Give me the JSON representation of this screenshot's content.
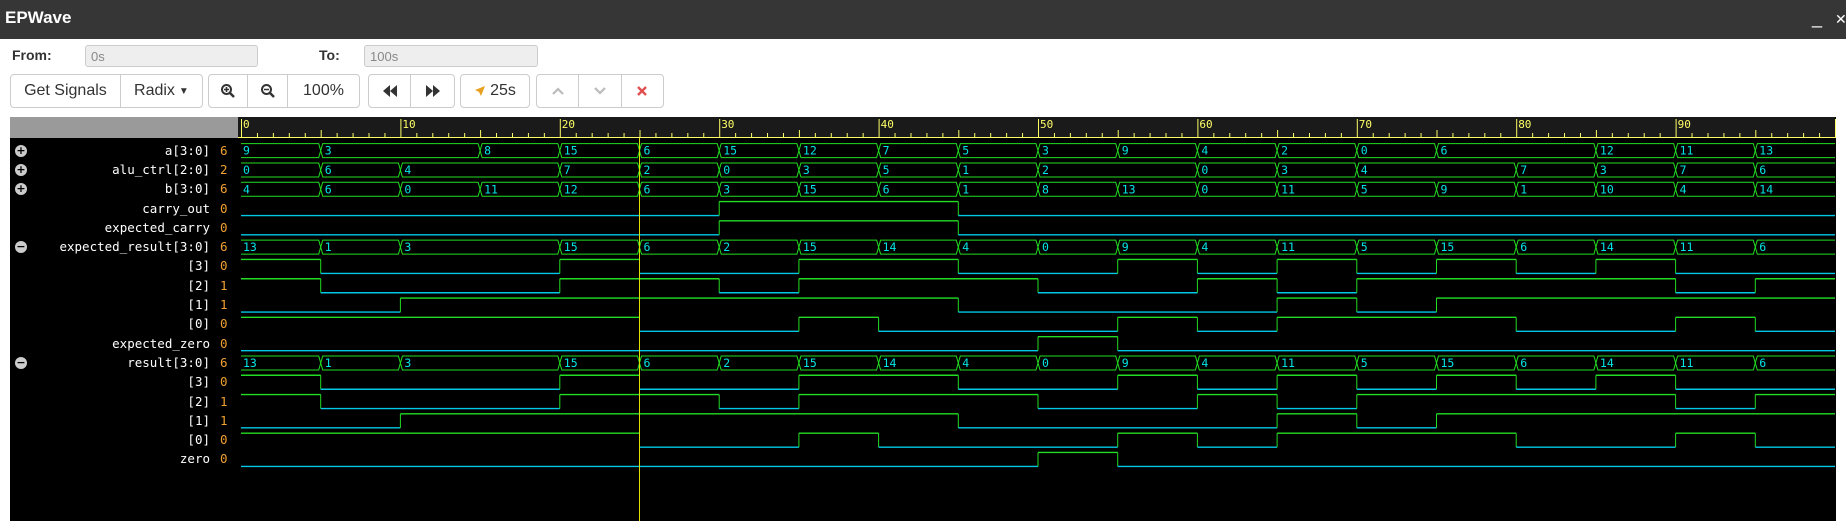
{
  "window": {
    "title": "EPWave",
    "minimize": "_",
    "close": "✕"
  },
  "range": {
    "from_label": "From:",
    "from_value": "0s",
    "to_label": "To:",
    "to_value": "100s"
  },
  "toolbar": {
    "get_signals": "Get Signals",
    "radix": "Radix",
    "zoom_in_icon": "zoom-in-icon",
    "zoom_out_icon": "zoom-out-icon",
    "zoom_level": "100%",
    "rewind_icon": "rewind-icon",
    "fast_forward_icon": "fast-forward-icon",
    "cursor_time": "25s",
    "up_icon": "chevron-up-icon",
    "down_icon": "chevron-down-icon",
    "remove_icon": "close-icon"
  },
  "colors": {
    "bus": "#00e5e5",
    "bit_high": "#22dd22",
    "bit_low": "#00c8e6",
    "ruler": "#ffff66",
    "cursor": "#e0e000",
    "value": "#f0a030"
  },
  "timeline": {
    "start": 0,
    "end": 100,
    "labels": [
      "0",
      "10",
      "20",
      "30",
      "40",
      "50",
      "60",
      "70",
      "80",
      "90"
    ],
    "cursor_time": 25
  },
  "signals": [
    {
      "name": "a[3:0]",
      "value": "6",
      "type": "bus",
      "expand": "+",
      "changes": [
        [
          0,
          "9"
        ],
        [
          5,
          "3"
        ],
        [
          15,
          "8"
        ],
        [
          20,
          "15"
        ],
        [
          25,
          "6"
        ],
        [
          30,
          "15"
        ],
        [
          35,
          "12"
        ],
        [
          40,
          "7"
        ],
        [
          45,
          "5"
        ],
        [
          50,
          "3"
        ],
        [
          55,
          "9"
        ],
        [
          60,
          "4"
        ],
        [
          65,
          "2"
        ],
        [
          70,
          "0"
        ],
        [
          75,
          "6"
        ],
        [
          85,
          "12"
        ],
        [
          90,
          "11"
        ],
        [
          95,
          "13"
        ]
      ]
    },
    {
      "name": "alu_ctrl[2:0]",
      "value": "2",
      "type": "bus",
      "expand": "+",
      "changes": [
        [
          0,
          "0"
        ],
        [
          5,
          "6"
        ],
        [
          10,
          "4"
        ],
        [
          20,
          "7"
        ],
        [
          25,
          "2"
        ],
        [
          30,
          "0"
        ],
        [
          35,
          "3"
        ],
        [
          40,
          "5"
        ],
        [
          45,
          "1"
        ],
        [
          50,
          "2"
        ],
        [
          60,
          "0"
        ],
        [
          65,
          "3"
        ],
        [
          70,
          "4"
        ],
        [
          80,
          "7"
        ],
        [
          85,
          "3"
        ],
        [
          90,
          "7"
        ],
        [
          95,
          "6"
        ]
      ]
    },
    {
      "name": "b[3:0]",
      "value": "6",
      "type": "bus",
      "expand": "+",
      "changes": [
        [
          0,
          "4"
        ],
        [
          5,
          "6"
        ],
        [
          10,
          "0"
        ],
        [
          15,
          "11"
        ],
        [
          20,
          "12"
        ],
        [
          25,
          "6"
        ],
        [
          30,
          "3"
        ],
        [
          35,
          "15"
        ],
        [
          40,
          "6"
        ],
        [
          45,
          "1"
        ],
        [
          50,
          "8"
        ],
        [
          55,
          "13"
        ],
        [
          60,
          "0"
        ],
        [
          65,
          "11"
        ],
        [
          70,
          "5"
        ],
        [
          75,
          "9"
        ],
        [
          80,
          "1"
        ],
        [
          85,
          "10"
        ],
        [
          90,
          "4"
        ],
        [
          95,
          "14"
        ]
      ]
    },
    {
      "name": "carry_out",
      "value": "0",
      "type": "bit",
      "changes": [
        [
          0,
          0
        ],
        [
          30,
          1
        ],
        [
          45,
          0
        ]
      ]
    },
    {
      "name": "expected_carry",
      "value": "0",
      "type": "bit",
      "changes": [
        [
          0,
          0
        ],
        [
          30,
          1
        ],
        [
          45,
          0
        ]
      ]
    },
    {
      "name": "expected_result[3:0]",
      "value": "6",
      "type": "bus",
      "expand": "−",
      "changes": [
        [
          0,
          "13"
        ],
        [
          5,
          "1"
        ],
        [
          10,
          "3"
        ],
        [
          20,
          "15"
        ],
        [
          25,
          "6"
        ],
        [
          30,
          "2"
        ],
        [
          35,
          "15"
        ],
        [
          40,
          "14"
        ],
        [
          45,
          "4"
        ],
        [
          50,
          "0"
        ],
        [
          55,
          "9"
        ],
        [
          60,
          "4"
        ],
        [
          65,
          "11"
        ],
        [
          70,
          "5"
        ],
        [
          75,
          "15"
        ],
        [
          80,
          "6"
        ],
        [
          85,
          "14"
        ],
        [
          90,
          "11"
        ],
        [
          95,
          "6"
        ]
      ]
    },
    {
      "name": "[3]",
      "value": "0",
      "type": "bit",
      "changes": [
        [
          0,
          1
        ],
        [
          5,
          0
        ],
        [
          20,
          1
        ],
        [
          25,
          0
        ],
        [
          35,
          1
        ],
        [
          45,
          0
        ],
        [
          55,
          1
        ],
        [
          60,
          0
        ],
        [
          65,
          1
        ],
        [
          70,
          0
        ],
        [
          75,
          1
        ],
        [
          80,
          0
        ],
        [
          85,
          1
        ],
        [
          90,
          0
        ]
      ]
    },
    {
      "name": "[2]",
      "value": "1",
      "type": "bit",
      "changes": [
        [
          0,
          1
        ],
        [
          5,
          0
        ],
        [
          20,
          1
        ],
        [
          30,
          0
        ],
        [
          35,
          1
        ],
        [
          50,
          0
        ],
        [
          60,
          1
        ],
        [
          65,
          0
        ],
        [
          70,
          1
        ],
        [
          90,
          0
        ],
        [
          95,
          1
        ]
      ]
    },
    {
      "name": "[1]",
      "value": "1",
      "type": "bit",
      "changes": [
        [
          0,
          0
        ],
        [
          10,
          1
        ],
        [
          45,
          0
        ],
        [
          65,
          1
        ],
        [
          70,
          0
        ],
        [
          75,
          1
        ]
      ]
    },
    {
      "name": "[0]",
      "value": "0",
      "type": "bit",
      "changes": [
        [
          0,
          1
        ],
        [
          25,
          0
        ],
        [
          35,
          1
        ],
        [
          40,
          0
        ],
        [
          55,
          1
        ],
        [
          60,
          0
        ],
        [
          65,
          1
        ],
        [
          80,
          0
        ],
        [
          90,
          1
        ],
        [
          95,
          0
        ]
      ]
    },
    {
      "name": "expected_zero",
      "value": "0",
      "type": "bit",
      "changes": [
        [
          0,
          0
        ],
        [
          50,
          1
        ],
        [
          55,
          0
        ]
      ]
    },
    {
      "name": "result[3:0]",
      "value": "6",
      "type": "bus",
      "expand": "−",
      "changes": [
        [
          0,
          "13"
        ],
        [
          5,
          "1"
        ],
        [
          10,
          "3"
        ],
        [
          20,
          "15"
        ],
        [
          25,
          "6"
        ],
        [
          30,
          "2"
        ],
        [
          35,
          "15"
        ],
        [
          40,
          "14"
        ],
        [
          45,
          "4"
        ],
        [
          50,
          "0"
        ],
        [
          55,
          "9"
        ],
        [
          60,
          "4"
        ],
        [
          65,
          "11"
        ],
        [
          70,
          "5"
        ],
        [
          75,
          "15"
        ],
        [
          80,
          "6"
        ],
        [
          85,
          "14"
        ],
        [
          90,
          "11"
        ],
        [
          95,
          "6"
        ]
      ]
    },
    {
      "name": "[3]",
      "value": "0",
      "type": "bit",
      "changes": [
        [
          0,
          1
        ],
        [
          5,
          0
        ],
        [
          20,
          1
        ],
        [
          25,
          0
        ],
        [
          35,
          1
        ],
        [
          45,
          0
        ],
        [
          55,
          1
        ],
        [
          60,
          0
        ],
        [
          65,
          1
        ],
        [
          70,
          0
        ],
        [
          75,
          1
        ],
        [
          80,
          0
        ],
        [
          85,
          1
        ],
        [
          90,
          0
        ]
      ]
    },
    {
      "name": "[2]",
      "value": "1",
      "type": "bit",
      "changes": [
        [
          0,
          1
        ],
        [
          5,
          0
        ],
        [
          20,
          1
        ],
        [
          30,
          0
        ],
        [
          35,
          1
        ],
        [
          50,
          0
        ],
        [
          60,
          1
        ],
        [
          65,
          0
        ],
        [
          70,
          1
        ],
        [
          90,
          0
        ],
        [
          95,
          1
        ]
      ]
    },
    {
      "name": "[1]",
      "value": "1",
      "type": "bit",
      "changes": [
        [
          0,
          0
        ],
        [
          10,
          1
        ],
        [
          45,
          0
        ],
        [
          65,
          1
        ],
        [
          70,
          0
        ],
        [
          75,
          1
        ]
      ]
    },
    {
      "name": "[0]",
      "value": "0",
      "type": "bit",
      "changes": [
        [
          0,
          1
        ],
        [
          25,
          0
        ],
        [
          35,
          1
        ],
        [
          40,
          0
        ],
        [
          55,
          1
        ],
        [
          60,
          0
        ],
        [
          65,
          1
        ],
        [
          80,
          0
        ],
        [
          90,
          1
        ],
        [
          95,
          0
        ]
      ]
    },
    {
      "name": "zero",
      "value": "0",
      "type": "bit",
      "changes": [
        [
          0,
          0
        ],
        [
          50,
          1
        ],
        [
          55,
          0
        ]
      ]
    }
  ]
}
